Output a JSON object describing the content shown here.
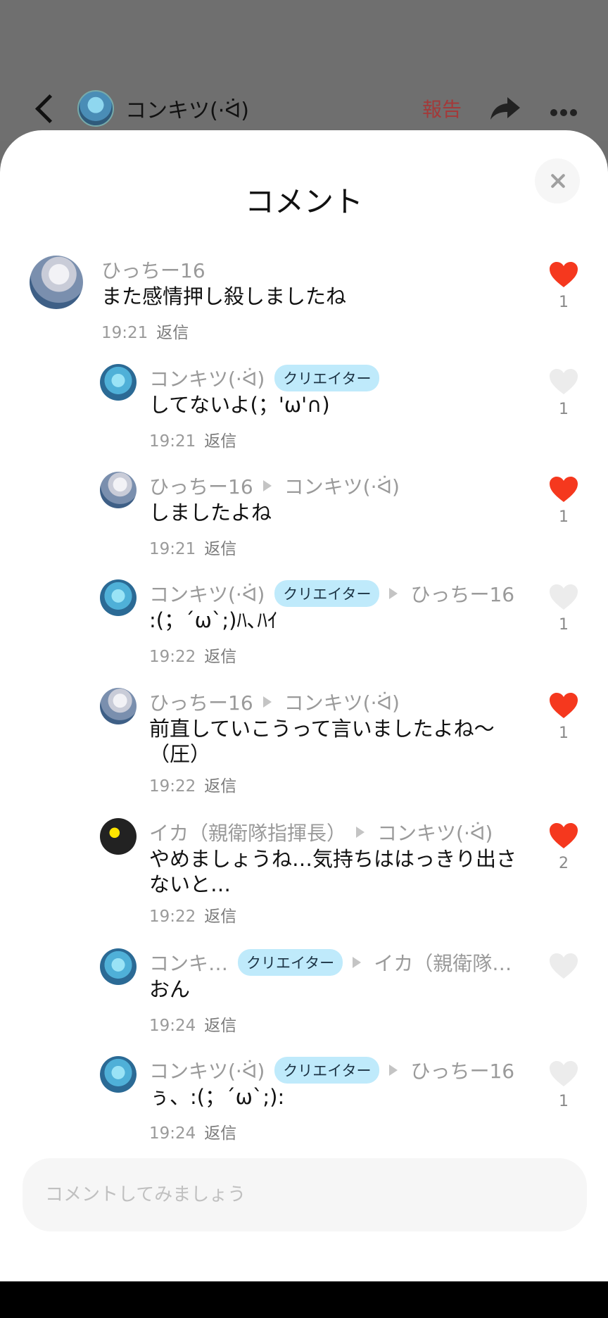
{
  "header": {
    "title": "コンキツ(·ᐛ)",
    "report_label": "報告",
    "icons": [
      "back-icon",
      "share-icon",
      "more-icon"
    ]
  },
  "sheet": {
    "title": "コメント",
    "close_icon": "close-icon"
  },
  "comments": [
    {
      "name": "ひっちー16",
      "badge": "",
      "reply_to": "",
      "text": "また感情押し殺しましたね",
      "time": "19:21",
      "reply": "返信",
      "likes": "1",
      "liked": true
    },
    {
      "name": "コンキツ(·ᐛ)",
      "badge": "クリエイター",
      "reply_to": "",
      "text": "してないよ(；'ω'∩)",
      "time": "19:21",
      "reply": "返信",
      "likes": "1",
      "liked": false
    },
    {
      "name": "ひっちー16",
      "badge": "",
      "reply_to": "コンキツ(·ᐛ)",
      "text": "しましたよね",
      "time": "19:21",
      "reply": "返信",
      "likes": "1",
      "liked": true
    },
    {
      "name": "コンキツ(·ᐛ)",
      "badge": "クリエイター",
      "reply_to": "ひっちー16",
      "text": ":(；´ω`;)ﾊ､ﾊｲ",
      "time": "19:22",
      "reply": "返信",
      "likes": "1",
      "liked": false
    },
    {
      "name": "ひっちー16",
      "badge": "",
      "reply_to": "コンキツ(·ᐛ)",
      "text": "前直していこうって言いましたよね〜（圧）",
      "time": "19:22",
      "reply": "返信",
      "likes": "1",
      "liked": true
    },
    {
      "name": "イカ（親衛隊指揮長）",
      "badge": "",
      "reply_to": "コンキツ(·ᐛ)",
      "text": "やめましょうね…気持ちははっきり出さないと…",
      "time": "19:22",
      "reply": "返信",
      "likes": "2",
      "liked": true
    },
    {
      "name": "コンキ…",
      "badge": "クリエイター",
      "reply_to": "イカ（親衛隊…",
      "text": "おん",
      "time": "19:24",
      "reply": "返信",
      "likes": "",
      "liked": false
    },
    {
      "name": "コンキツ(·ᐛ)",
      "badge": "クリエイター",
      "reply_to": "ひっちー16",
      "text": "ぅ、:(；´ω`;):",
      "time": "19:24",
      "reply": "返信",
      "likes": "1",
      "liked": false
    }
  ],
  "input": {
    "placeholder": "コメントしてみましょう"
  },
  "colors": {
    "liked": "#f5381e",
    "unliked": "#ececec",
    "badge_bg": "#bfeafb",
    "report": "#a33a3a"
  }
}
